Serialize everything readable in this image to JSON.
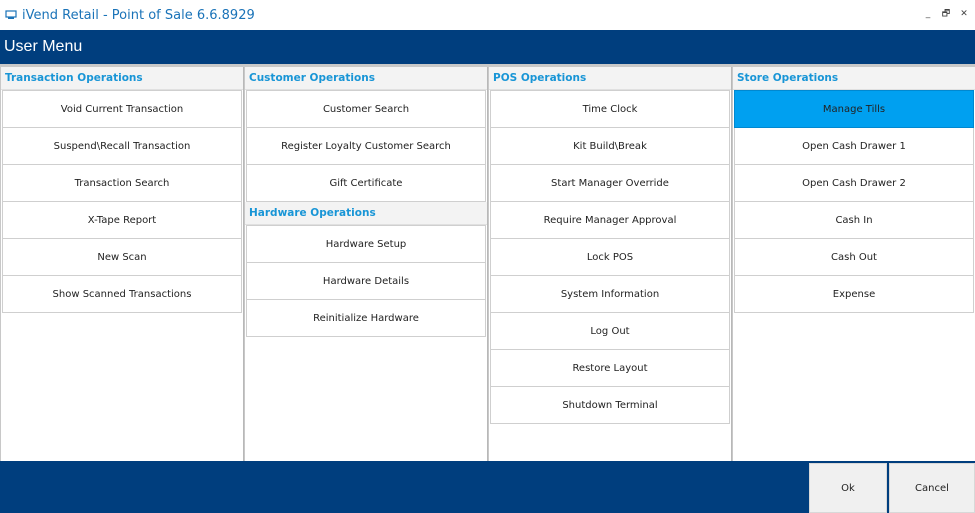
{
  "window": {
    "title": "iVend Retail - Point of Sale 6.6.8929",
    "minimize": "_",
    "restore": "🗗",
    "close": "✕"
  },
  "header": {
    "title": "User Menu"
  },
  "columns": [
    {
      "sections": [
        {
          "title": "Transaction Operations",
          "items": [
            "Void Current Transaction",
            "Suspend\\Recall Transaction",
            "Transaction Search",
            "X-Tape Report",
            "New Scan",
            "Show Scanned Transactions"
          ]
        }
      ]
    },
    {
      "sections": [
        {
          "title": "Customer Operations",
          "items": [
            "Customer Search",
            "Register Loyalty Customer Search",
            "Gift Certificate"
          ]
        },
        {
          "title": "Hardware Operations",
          "items": [
            "Hardware Setup",
            "Hardware Details",
            "Reinitialize Hardware"
          ]
        }
      ]
    },
    {
      "sections": [
        {
          "title": "POS Operations",
          "items": [
            "Time Clock",
            "Kit Build\\Break",
            "Start Manager Override",
            "Require Manager Approval",
            "Lock POS",
            "System Information",
            "Log Out",
            "Restore Layout",
            "Shutdown Terminal"
          ]
        }
      ]
    },
    {
      "sections": [
        {
          "title": "Store Operations",
          "items": [
            "Manage Tills",
            "Open Cash Drawer 1",
            "Open Cash Drawer 2",
            "Cash In",
            "Cash Out",
            "Expense"
          ],
          "selected": "Manage Tills"
        }
      ]
    }
  ],
  "footer": {
    "ok_label": "Ok",
    "cancel_label": "Cancel"
  },
  "colors": {
    "header_bg": "#003e7e",
    "section_title": "#1895d6",
    "selected_bg": "#00a0f0"
  },
  "icons": {
    "app": "pos-app-icon"
  }
}
